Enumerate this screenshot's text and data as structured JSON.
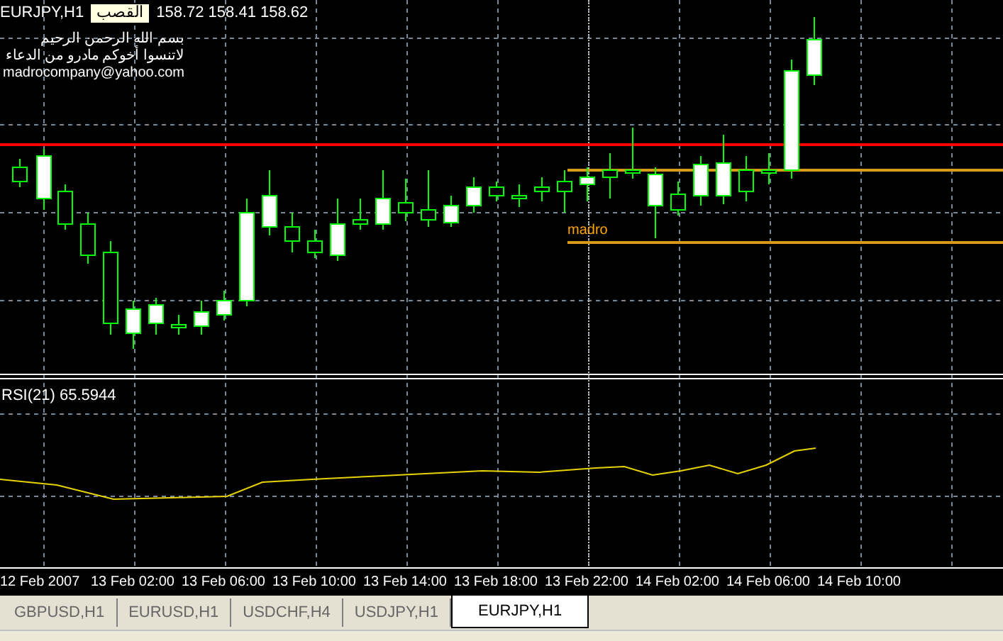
{
  "chart": {
    "symbol": "EURJPY,H1",
    "quote": "158.72 158.41 158.62",
    "tooltip": "القصب",
    "notes": [
      "بسم الله الرحمن الرحيم",
      "لاتنسوا أخوكم مادرو من الدعاء",
      "madrocompany@yahoo.com"
    ],
    "line_label": "madro"
  },
  "indicator": {
    "label": "RSI(21) 65.5944"
  },
  "time_axis": [
    "12 Feb 2007",
    "13 Feb 02:00",
    "13 Feb 06:00",
    "13 Feb 10:00",
    "13 Feb 14:00",
    "13 Feb 18:00",
    "13 Feb 22:00",
    "14 Feb 02:00",
    "14 Feb 06:00",
    "14 Feb 10:00"
  ],
  "tabs": [
    {
      "label": "GBPUSD,H1",
      "selected": false
    },
    {
      "label": "EURUSD,H1",
      "selected": false
    },
    {
      "label": "USDCHF,H4",
      "selected": false
    },
    {
      "label": "USDJPY,H1",
      "selected": false
    },
    {
      "label": "EURJPY,H1",
      "selected": true
    }
  ]
}
